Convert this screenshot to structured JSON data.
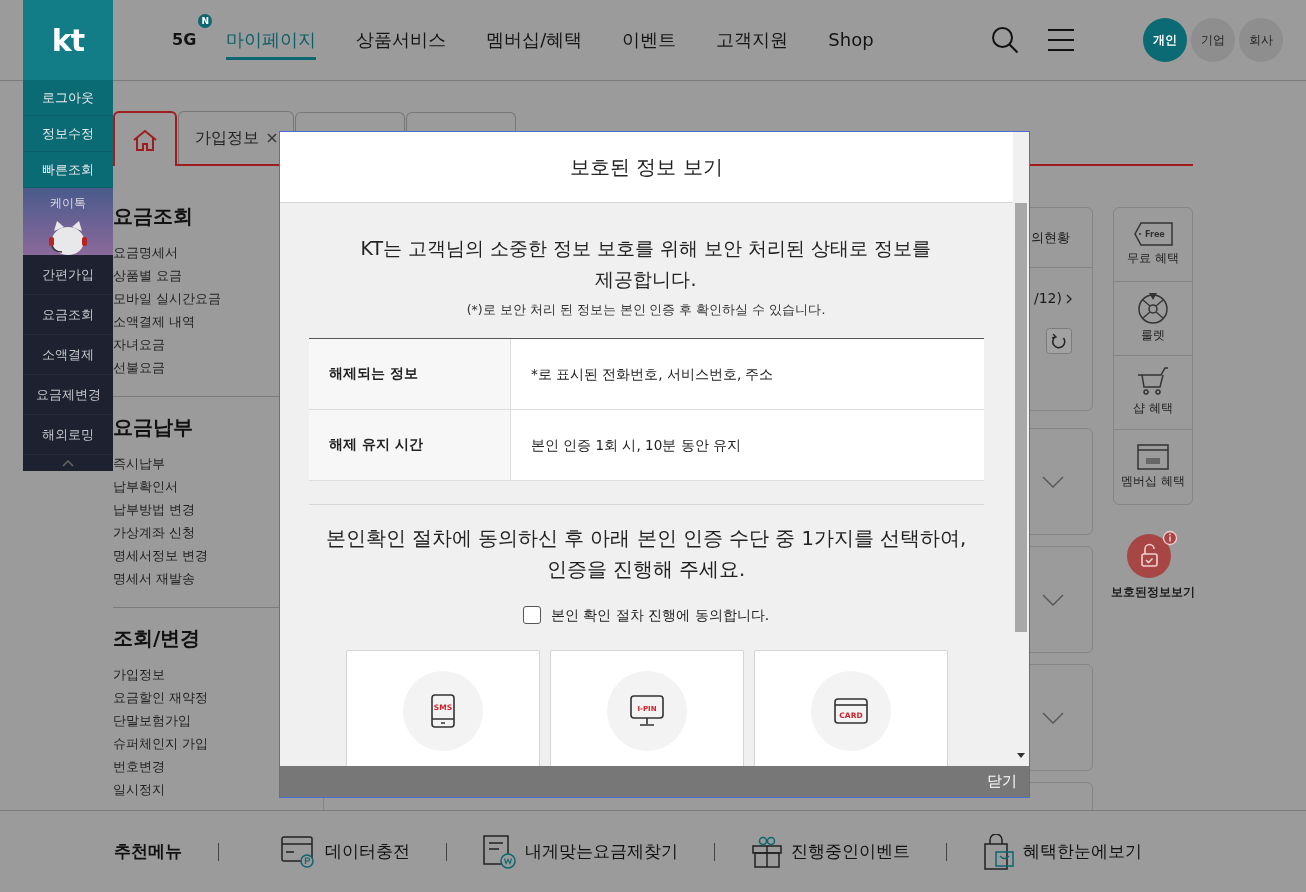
{
  "header": {
    "logo": "kt",
    "nav": [
      {
        "label": "5G",
        "badge": "N",
        "selected": false
      },
      {
        "label": "마이페이지",
        "selected": true
      },
      {
        "label": "상품서비스",
        "selected": false
      },
      {
        "label": "멤버십/혜택",
        "selected": false
      },
      {
        "label": "이벤트",
        "selected": false
      },
      {
        "label": "고객지원",
        "selected": false
      },
      {
        "label": "Shop",
        "selected": false
      }
    ],
    "segments": [
      {
        "label": "개인",
        "selected": true
      },
      {
        "label": "기업",
        "selected": false
      },
      {
        "label": "회사",
        "selected": false
      }
    ]
  },
  "quick_panel": [
    {
      "label": "로그아웃",
      "kind": "account"
    },
    {
      "label": "정보수정",
      "kind": "account"
    },
    {
      "label": "빠른조회",
      "kind": "account"
    },
    {
      "label": "케이톡",
      "kind": "chatbot"
    },
    {
      "label": "간편가입",
      "kind": "menu"
    },
    {
      "label": "요금조회",
      "kind": "menu"
    },
    {
      "label": "소액결제",
      "kind": "menu"
    },
    {
      "label": "요금제변경",
      "kind": "menu"
    },
    {
      "label": "해외로밍",
      "kind": "menu"
    },
    {
      "kind": "collapse"
    }
  ],
  "tabs": [
    {
      "kind": "home",
      "selected": true
    },
    {
      "kind": "text",
      "label": "가입정보",
      "closable": true,
      "selected": false
    },
    {
      "kind": "blank",
      "selected": false
    },
    {
      "kind": "blank",
      "selected": false
    }
  ],
  "side_menu": [
    {
      "title": "요금조회",
      "items": [
        "요금명세서",
        "상품별 요금",
        "모바일 실시간요금",
        "소액결제 내역",
        "자녀요금",
        "선불요금"
      ]
    },
    {
      "title": "요금납부",
      "items": [
        "즉시납부",
        "납부확인서",
        "납부방법 변경",
        "가상계좌 신청",
        "명세서정보 변경",
        "명세서 재발송"
      ]
    },
    {
      "title": "조회/변경",
      "items": [
        "가입정보",
        "요금할인 재약정",
        "단말보험가입",
        "슈퍼체인지 가입",
        "번호변경",
        "일시정지"
      ]
    }
  ],
  "summary_card": {
    "title_fragment": "의현황",
    "period_fragment": "/12)"
  },
  "accordions": [
    {
      "expanded": false
    },
    {
      "expanded": false
    },
    {
      "expanded": false
    }
  ],
  "benefits": [
    {
      "label": "무료 혜택",
      "kind": "free",
      "icon_text": "Free"
    },
    {
      "label": "룰렛",
      "kind": "roulette"
    },
    {
      "label": "샵 혜택",
      "kind": "shop"
    },
    {
      "label": "멤버십 혜택",
      "kind": "membership"
    }
  ],
  "protected_button": {
    "label": "보호된정보보기"
  },
  "footer": {
    "title": "추천메뉴",
    "items": [
      {
        "label": "데이터충전",
        "kind": "data"
      },
      {
        "label": "내게맞는요금제찾기",
        "kind": "plan"
      },
      {
        "label": "진행중인이벤트",
        "kind": "event"
      },
      {
        "label": "혜택한눈에보기",
        "kind": "benefit"
      }
    ]
  },
  "modal": {
    "title": "보호된 정보 보기",
    "intro": "KT는 고객님의 소중한 정보 보호를 위해 보안 처리된 상태로 정보를 제공합니다.",
    "note": "(*)로 보안 처리 된 정보는 본인 인증 후 확인하실 수 있습니다.",
    "table": [
      {
        "label": "해제되는 정보",
        "value": "*로 표시된 전화번호, 서비스번호, 주소"
      },
      {
        "label": "해제 유지 시간",
        "value": "본인 인증 1회 시, 10분 동안 유지"
      }
    ],
    "instruction": "본인확인 절차에 동의하신 후 아래 본인 인증 수단 중 1가지를 선택하여, 인증을 진행해 주세요.",
    "consent": {
      "label": "본인 확인 절차 진행에 동의합니다.",
      "checked": false
    },
    "methods": [
      {
        "kind": "phone",
        "icon_text": "SMS"
      },
      {
        "kind": "monitor",
        "icon_text": "I-PIN"
      },
      {
        "kind": "card",
        "icon_text": "CARD"
      }
    ],
    "close": "닫기"
  }
}
